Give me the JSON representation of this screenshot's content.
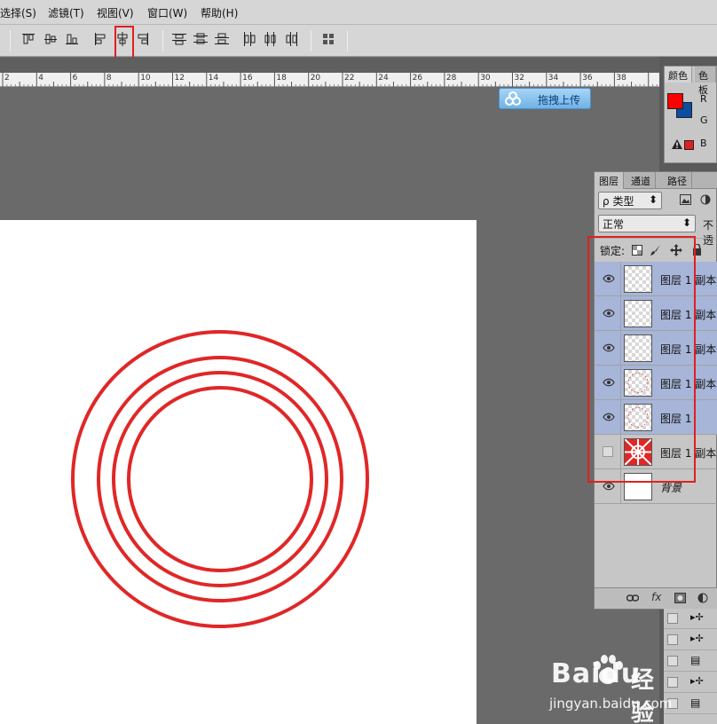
{
  "menu": {
    "items": [
      "选择(S)",
      "滤镜(T)",
      "视图(V)",
      "窗口(W)",
      "帮助(H)"
    ]
  },
  "toolbar": {
    "buttons": [
      "align-top-edges-icon",
      "align-vertical-centers-icon",
      "align-bottom-edges-icon",
      "align-left-edges-icon",
      "align-horizontal-centers-icon",
      "align-right-edges-icon",
      "distribute-top-icon",
      "distribute-vertical-centers-icon",
      "distribute-bottom-icon",
      "distribute-left-icon",
      "distribute-horizontal-centers-icon",
      "distribute-right-icon",
      "auto-align-icon"
    ]
  },
  "ruler": {
    "labels": [
      "2",
      "4",
      "6",
      "8",
      "10",
      "12",
      "14",
      "16",
      "18",
      "20",
      "22",
      "24",
      "26",
      "28",
      "30",
      "32",
      "34",
      "36",
      "38"
    ]
  },
  "upload": {
    "label": "拖拽上传"
  },
  "color_panel": {
    "tabs": [
      "颜色",
      "色板"
    ],
    "channels": [
      "R",
      "G",
      "B"
    ],
    "foreground": "#ff0000",
    "background": "#0b4ea2"
  },
  "layers_panel": {
    "tabs": [
      "图层",
      "通道",
      "路径"
    ],
    "filter_label": "类型",
    "blend_mode": "正常",
    "opacity_label": "不透",
    "lock_label": "锁定:",
    "layers": [
      {
        "name": "图层 1 副本",
        "visible": true,
        "selected": true
      },
      {
        "name": "图层 1 副本",
        "visible": true,
        "selected": true
      },
      {
        "name": "图层 1 副本",
        "visible": true,
        "selected": true
      },
      {
        "name": "图层 1 副本",
        "visible": true,
        "selected": true
      },
      {
        "name": "图层 1",
        "visible": true,
        "selected": true
      },
      {
        "name": "图层 1 副本",
        "visible": false,
        "selected": false
      },
      {
        "name": "背景",
        "visible": true,
        "selected": false
      }
    ]
  },
  "canvas": {
    "ring_color": "#e02727"
  },
  "watermark": {
    "brand": "Baidu",
    "suffix": "经验",
    "url": "jingyan.baidu.com"
  }
}
